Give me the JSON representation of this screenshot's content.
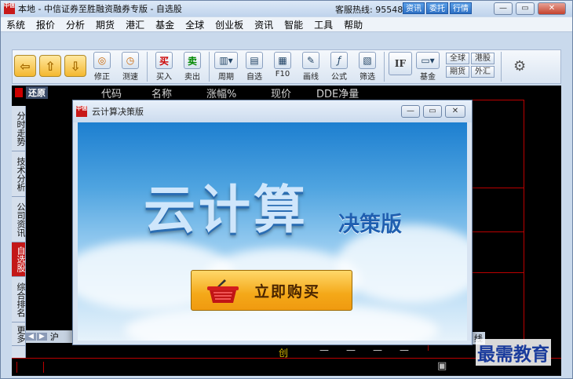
{
  "window": {
    "title": "本地 - 中信证券至胜融资融券专版 - 自选股",
    "hotline_label": "客服热线: 95548",
    "header_buttons": [
      "资讯",
      "委托",
      "行情"
    ]
  },
  "menu": [
    "系统",
    "报价",
    "分析",
    "期货",
    "港汇",
    "基金",
    "全球",
    "创业板",
    "资讯",
    "智能",
    "工具",
    "帮助"
  ],
  "toolbar": {
    "items": [
      {
        "label": "修正",
        "icon": "revise-icon"
      },
      {
        "label": "测速",
        "icon": "speed-test-icon"
      },
      {
        "label": "买入",
        "icon": "buy-icon",
        "glyph": "买"
      },
      {
        "label": "卖出",
        "icon": "sell-icon",
        "glyph": "卖"
      },
      {
        "label": "周期",
        "icon": "period-icon"
      },
      {
        "label": "自选",
        "icon": "watchlist-icon"
      },
      {
        "label": "F10",
        "icon": "f10-icon"
      },
      {
        "label": "画线",
        "icon": "draw-line-icon"
      },
      {
        "label": "公式",
        "icon": "formula-icon"
      },
      {
        "label": "筛选",
        "icon": "filter-icon"
      },
      {
        "label": "基金",
        "icon": "fund-icon"
      }
    ],
    "if_label": "IF",
    "small_buttons": [
      "全球",
      "港股",
      "期货",
      "外汇"
    ]
  },
  "main": {
    "restore_label": "还原",
    "columns": [
      "代码",
      "名称",
      "涨幅%",
      "现价",
      "DDE净量"
    ],
    "side_tabs": [
      "分时走势",
      "技术分析",
      "公司资讯",
      "自选股",
      "综合排名",
      "更多"
    ],
    "active_tab": "自选股",
    "bottom_left_tab": "沪",
    "bottom_mid_label": "创",
    "bottom_right_label": "线"
  },
  "dialog": {
    "title": "云计算决策版",
    "brand": "云计算",
    "edition": "决策版",
    "buy_button": "立即购买"
  },
  "watermark": "最需教育",
  "colors": {
    "accent_red": "#c31818",
    "title_blue": "#2c6fc4"
  }
}
